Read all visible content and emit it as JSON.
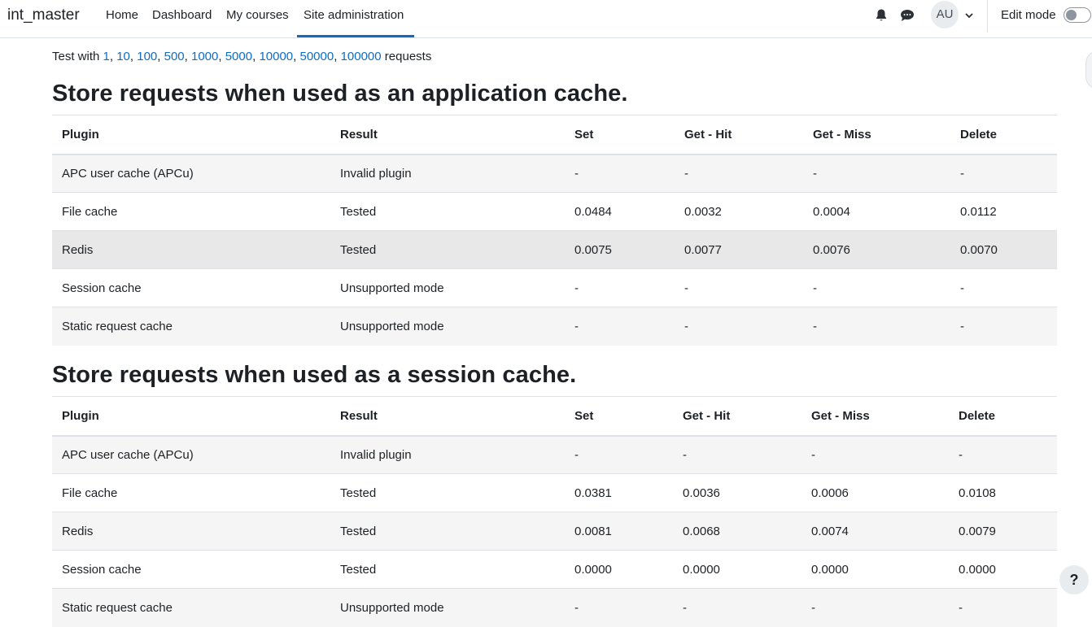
{
  "navbar": {
    "brand": "int_master",
    "items": [
      {
        "label": "Home"
      },
      {
        "label": "Dashboard"
      },
      {
        "label": "My courses"
      },
      {
        "label": "Site administration"
      }
    ],
    "avatar_initials": "AU",
    "edit_mode_label": "Edit mode",
    "edit_mode_on": false,
    "icons": [
      "bell-icon",
      "chat-bubble-icon",
      "chevron-down-icon"
    ]
  },
  "test_line": {
    "prefix": "Test with",
    "links": [
      "1",
      "10",
      "100",
      "500",
      "1000",
      "5000",
      "10000",
      "50000",
      "100000"
    ],
    "suffix": "requests"
  },
  "sections": [
    {
      "heading": "Store requests when used as an application cache.",
      "columns": [
        "Plugin",
        "Result",
        "Set",
        "Get - Hit",
        "Get - Miss",
        "Delete"
      ],
      "rows": [
        [
          "APC user cache (APCu)",
          "Invalid plugin",
          "-",
          "-",
          "-",
          "-"
        ],
        [
          "File cache",
          "Tested",
          "0.0484",
          "0.0032",
          "0.0004",
          "0.0112"
        ],
        [
          "Redis",
          "Tested",
          "0.0075",
          "0.0077",
          "0.0076",
          "0.0070"
        ],
        [
          "Session cache",
          "Unsupported mode",
          "-",
          "-",
          "-",
          "-"
        ],
        [
          "Static request cache",
          "Unsupported mode",
          "-",
          "-",
          "-",
          "-"
        ]
      ]
    },
    {
      "heading": "Store requests when used as a session cache.",
      "columns": [
        "Plugin",
        "Result",
        "Set",
        "Get - Hit",
        "Get - Miss",
        "Delete"
      ],
      "rows": [
        [
          "APC user cache (APCu)",
          "Invalid plugin",
          "-",
          "-",
          "-",
          "-"
        ],
        [
          "File cache",
          "Tested",
          "0.0381",
          "0.0036",
          "0.0006",
          "0.0108"
        ],
        [
          "Redis",
          "Tested",
          "0.0081",
          "0.0068",
          "0.0074",
          "0.0079"
        ],
        [
          "Session cache",
          "Tested",
          "0.0000",
          "0.0000",
          "0.0000",
          "0.0000"
        ],
        [
          "Static request cache",
          "Unsupported mode",
          "-",
          "-",
          "-",
          "-"
        ]
      ]
    }
  ],
  "help_label": "?",
  "colors": {
    "link": "#0f6cbf",
    "text": "#1d2125",
    "stripe": "#f5f5f5",
    "hover": "#e8e8e8"
  }
}
